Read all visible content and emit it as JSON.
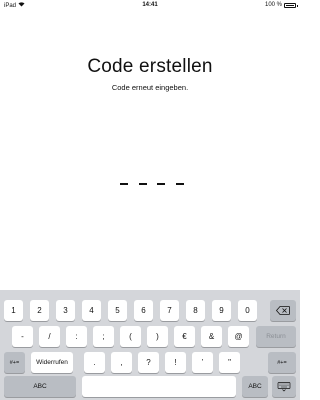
{
  "status_bar": {
    "device": "iPad",
    "time": "14:41",
    "battery_text": "100 %"
  },
  "passcode": {
    "title": "Code erstellen",
    "subtitle": "Code erneut eingeben.",
    "entered_digits": 0,
    "length": 4
  },
  "keyboard": {
    "row1": [
      "1",
      "2",
      "3",
      "4",
      "5",
      "6",
      "7",
      "8",
      "9",
      "0"
    ],
    "row2": [
      "-",
      "/",
      ":",
      ";",
      "(",
      ")",
      "€",
      "&",
      "@"
    ],
    "return_label": "Return",
    "row3_left_mode": "#+=",
    "undo_label": "Widerrufen",
    "row3": [
      ".",
      ",",
      "?",
      "!",
      "’",
      "\""
    ],
    "row3_right_mode": "#+=",
    "abc_left": "ABC",
    "abc_right": "ABC"
  }
}
